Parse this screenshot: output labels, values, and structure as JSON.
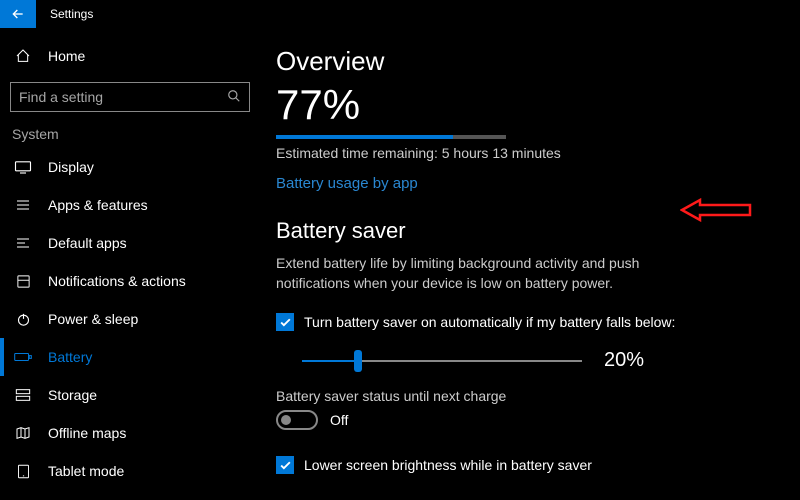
{
  "titlebar": {
    "title": "Settings"
  },
  "sidebar": {
    "home": "Home",
    "search_placeholder": "Find a setting",
    "category": "System",
    "items": [
      {
        "label": "Display"
      },
      {
        "label": "Apps & features"
      },
      {
        "label": "Default apps"
      },
      {
        "label": "Notifications & actions"
      },
      {
        "label": "Power & sleep"
      },
      {
        "label": "Battery",
        "active": true
      },
      {
        "label": "Storage"
      },
      {
        "label": "Offline maps"
      },
      {
        "label": "Tablet mode"
      }
    ]
  },
  "overview": {
    "title": "Overview",
    "percent_text": "77%",
    "percent_value": 77,
    "estimate": "Estimated time remaining: 5 hours 13 minutes",
    "link": "Battery usage by app"
  },
  "saver": {
    "title": "Battery saver",
    "desc": "Extend battery life by limiting background activity and push notifications when your device is low on battery power.",
    "auto_checkbox_label": "Turn battery saver on automatically if my battery falls below:",
    "slider_value": 20,
    "slider_text": "20%",
    "status_label": "Battery saver status until next charge",
    "toggle_label": "Off",
    "brightness_checkbox_label": "Lower screen brightness while in battery saver"
  },
  "colors": {
    "accent": "#0078d7"
  }
}
